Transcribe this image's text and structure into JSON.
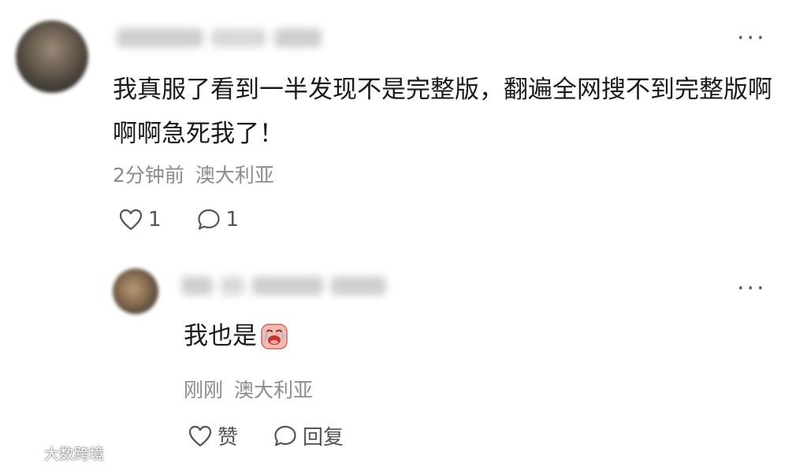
{
  "comment": {
    "username": "",
    "text": "我真服了看到一半发现不是完整版，翻遍全网搜不到完整版啊啊啊急死我了！",
    "time": "2分钟前",
    "location": "澳大利亚",
    "like_count": "1",
    "reply_count": "1",
    "avatar_icon": "avatar-icon",
    "more_icon": "more-dots-icon"
  },
  "reply": {
    "username": "",
    "text": "我也是",
    "emoji": "crying-face-emoji",
    "time": "刚刚",
    "location": "澳大利亚",
    "like_label": "赞",
    "reply_label": "回复"
  },
  "watermark": "大数跨境",
  "colors": {
    "text": "#1a1a1a",
    "meta": "#8c8c8c",
    "icon": "#555555"
  }
}
